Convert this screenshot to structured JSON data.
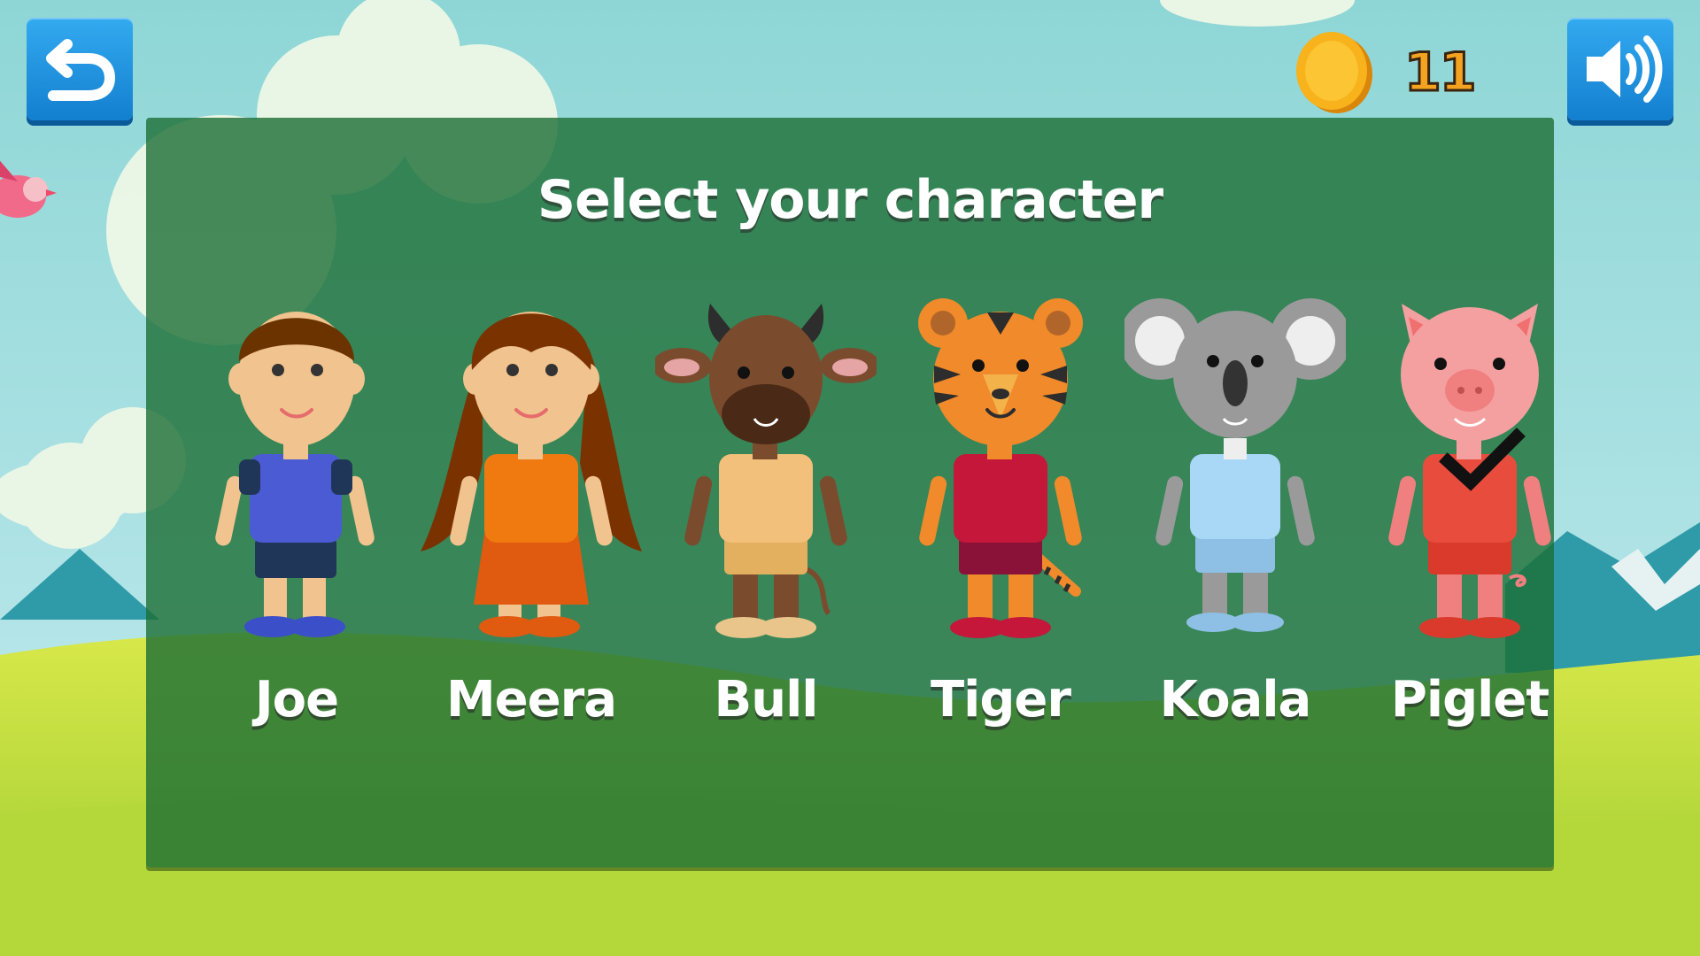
{
  "screen": {
    "title": "Select your character"
  },
  "hud": {
    "back_icon": "back-arrow-icon",
    "sound_icon": "speaker-volume-icon",
    "coin_icon": "gold-coin-icon",
    "coin_count": "11"
  },
  "characters": [
    {
      "name": "Joe",
      "selected": false,
      "shirt": "#4a5bd4",
      "shorts": "#1f3659"
    },
    {
      "name": "Meera",
      "selected": false,
      "shirt": "#f07a10",
      "shorts": "#e05a10"
    },
    {
      "name": "Bull",
      "selected": false,
      "shirt": "#f2c07a",
      "shorts": "#e3b060"
    },
    {
      "name": "Tiger",
      "selected": false,
      "shirt": "#c4173a",
      "shorts": "#8a1238"
    },
    {
      "name": "Koala",
      "selected": false,
      "shirt": "#a9d8f7",
      "shorts": "#8ec0e6"
    },
    {
      "name": "Piglet",
      "selected": true,
      "shirt": "#e84c3d",
      "shorts": "#d93a2b"
    }
  ],
  "colors": {
    "button_blue": "#1f8fe0",
    "panel_green": "#1c6e34",
    "coin_gold": "#f4a321",
    "sky": "#8ed4d8",
    "grass": "#b6d83a"
  }
}
